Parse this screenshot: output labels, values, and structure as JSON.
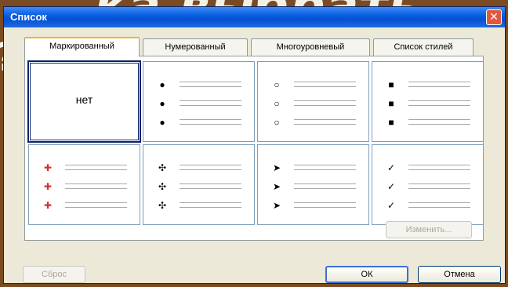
{
  "background": {
    "partial_text": "ка выбрать",
    "left_text": "?"
  },
  "dialog": {
    "title": "Список",
    "close_symbol": "✕",
    "tabs": [
      {
        "label": "Маркированный"
      },
      {
        "label": "Нумерованный"
      },
      {
        "label": "Многоуровневый"
      },
      {
        "label": "Список стилей"
      }
    ],
    "active_tab": "Маркированный",
    "styles": [
      {
        "kind": "none",
        "label": "нет"
      },
      {
        "kind": "bullet",
        "icon": "filled-circle-icon",
        "glyph": "●",
        "color": "#000000"
      },
      {
        "kind": "bullet",
        "icon": "hollow-circle-icon",
        "glyph": "○",
        "color": "#000000"
      },
      {
        "kind": "bullet",
        "icon": "square-icon",
        "glyph": "■",
        "color": "#000000"
      },
      {
        "kind": "bullet",
        "icon": "colored-arrow-icon",
        "glyph": "✚",
        "color": "#d0332e"
      },
      {
        "kind": "bullet",
        "icon": "four-diamond-icon",
        "glyph": "✣",
        "color": "#000000"
      },
      {
        "kind": "bullet",
        "icon": "arrowhead-icon",
        "glyph": "➤",
        "color": "#000000"
      },
      {
        "kind": "bullet",
        "icon": "checkmark-icon",
        "glyph": "✓",
        "color": "#000000"
      }
    ],
    "selected_index": 0,
    "buttons": {
      "modify": "Изменить...",
      "reset": "Сброс",
      "ok": "ОК",
      "cancel": "Отмена"
    }
  }
}
